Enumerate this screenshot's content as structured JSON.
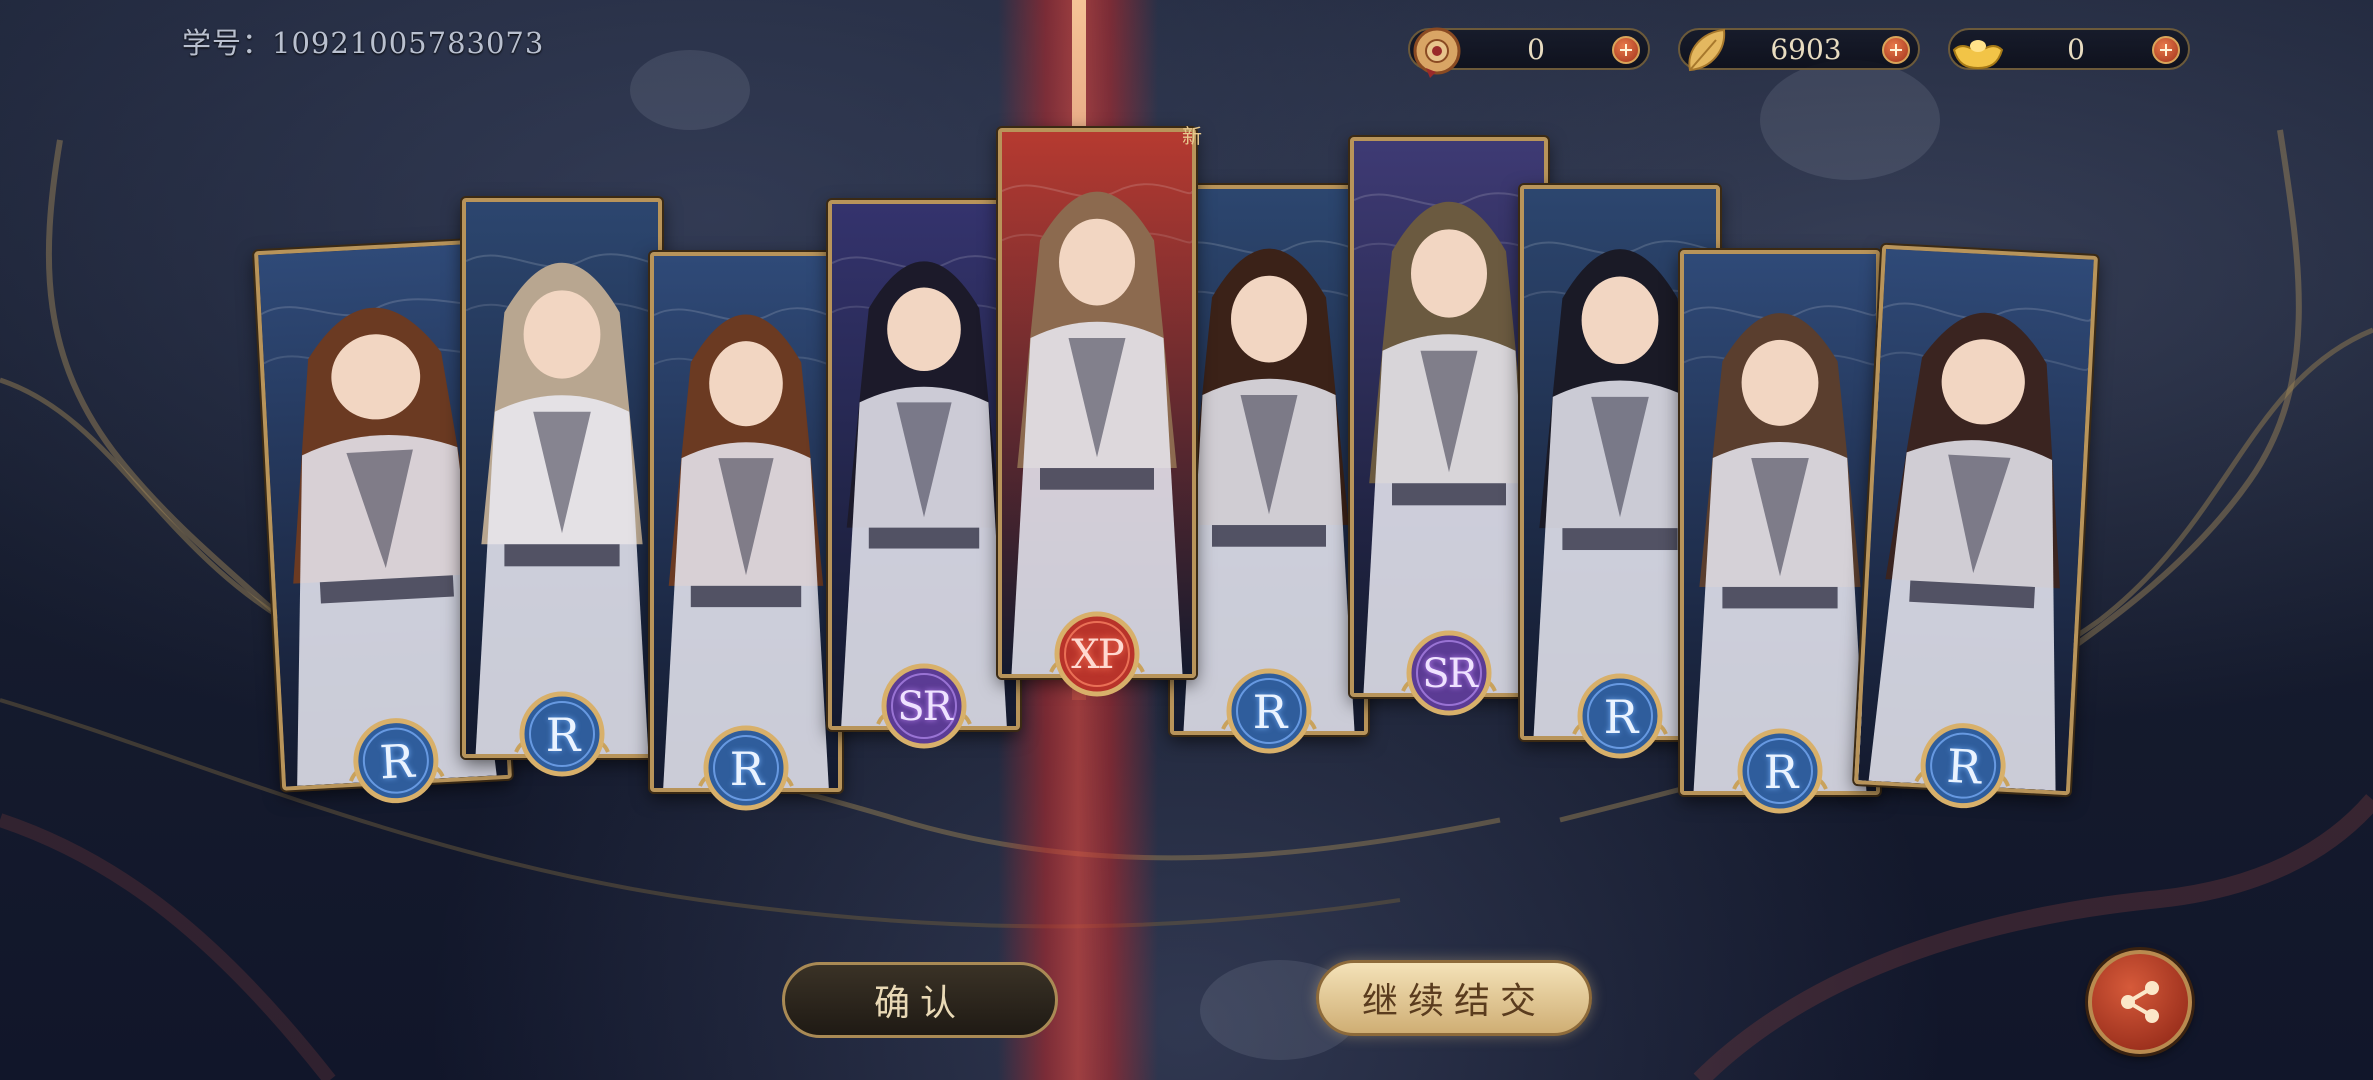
{
  "header": {
    "student_id_label": "学号：",
    "student_id_value": "10921005783073"
  },
  "currencies": [
    {
      "icon": "jade-medallion-icon",
      "value": "0"
    },
    {
      "icon": "golden-leaf-icon",
      "value": "6903"
    },
    {
      "icon": "gold-ingot-icon",
      "value": "0"
    }
  ],
  "cards": [
    {
      "rarity": "R",
      "icon": "rarity-r-badge-icon"
    },
    {
      "rarity": "R",
      "icon": "rarity-r-badge-icon"
    },
    {
      "rarity": "R",
      "icon": "rarity-r-badge-icon"
    },
    {
      "rarity": "SR",
      "icon": "rarity-sr-badge-icon"
    },
    {
      "rarity": "XP",
      "icon": "rarity-xp-badge-icon",
      "new_tag": "新"
    },
    {
      "rarity": "R",
      "icon": "rarity-r-badge-icon"
    },
    {
      "rarity": "SR",
      "icon": "rarity-sr-badge-icon"
    },
    {
      "rarity": "R",
      "icon": "rarity-r-badge-icon"
    },
    {
      "rarity": "R",
      "icon": "rarity-r-badge-icon"
    },
    {
      "rarity": "R",
      "icon": "rarity-r-badge-icon"
    }
  ],
  "buttons": {
    "confirm": "确认",
    "continue": "继续结交",
    "share_icon": "share-icon"
  },
  "colors": {
    "frame_gold": "#b8945a",
    "highlight_red": "#c0392b",
    "r_blue": "#3d6fb0",
    "sr_purple": "#7b4fb5"
  }
}
